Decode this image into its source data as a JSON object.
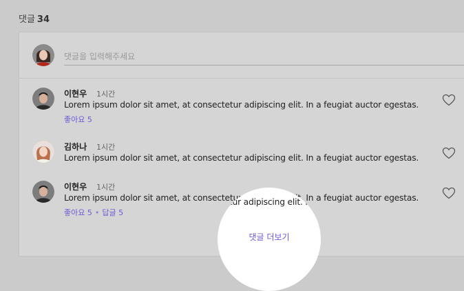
{
  "header": {
    "label": "댓글",
    "count": "34"
  },
  "input": {
    "placeholder": "댓글을 입력해주세요"
  },
  "comments": [
    {
      "name": "이현우",
      "time": "1시간",
      "text": "Lorem ipsum dolor sit amet, at consectetur adipiscing elit. In a feugiat auctor egestas.",
      "likes": "좋아요 5",
      "replies": "",
      "avatar": "male-avatar"
    },
    {
      "name": "김하나",
      "time": "1시간",
      "text": "Lorem ipsum dolor sit amet, at consectetur adipiscing elit. In a feugiat auctor egestas.",
      "likes": "",
      "replies": "",
      "avatar": "female-avatar"
    },
    {
      "name": "이현우",
      "time": "1시간",
      "text": "Lorem ipsum dolor sit amet, at consectetur adipiscing elit. In a feugiat auctor egestas.",
      "likes": "좋아요 5",
      "replies": "답글 5",
      "avatar": "male-avatar"
    }
  ],
  "more_button": "댓글 더보기",
  "colors": {
    "accent": "#6b5ad6",
    "background": "#cbcbcb",
    "panel": "#d5d5d5"
  }
}
